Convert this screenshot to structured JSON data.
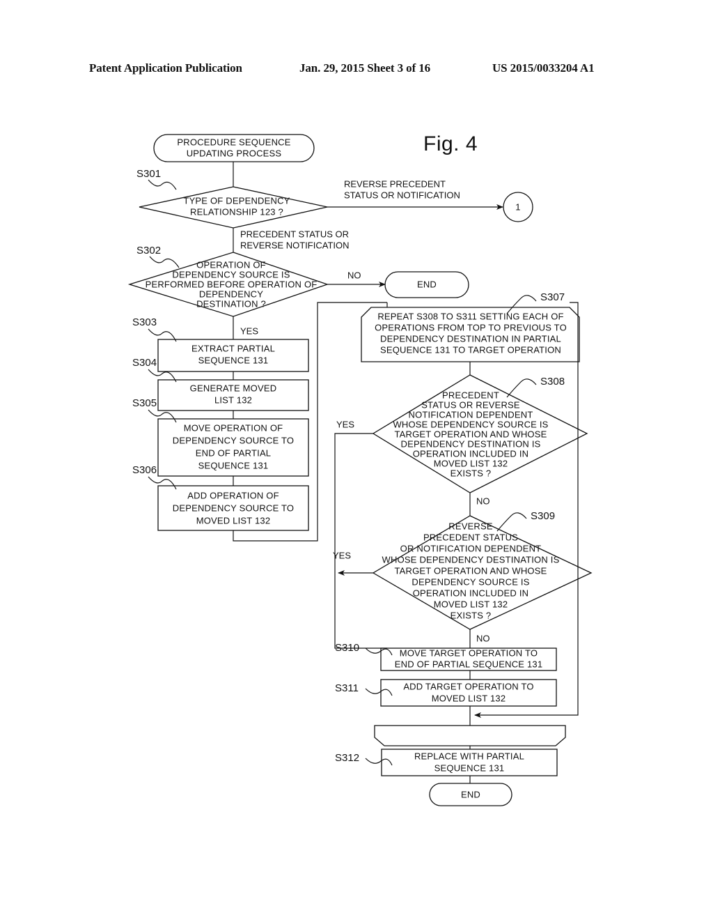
{
  "header": {
    "publication": "Patent Application Publication",
    "date_sheet": "Jan. 29, 2015  Sheet 3 of 16",
    "number": "US 2015/0033204 A1"
  },
  "figure": {
    "label": "Fig. 4"
  },
  "nodes": {
    "start": {
      "id": "start",
      "lines": [
        "PROCEDURE SEQUENCE",
        "UPDATING PROCESS"
      ]
    },
    "s301": {
      "id": "S301",
      "lines": [
        "TYPE OF DEPENDENCY",
        "RELATIONSHIP 123 ?"
      ]
    },
    "s302": {
      "id": "S302",
      "lines": [
        "OPERATION OF",
        "DEPENDENCY SOURCE IS",
        "PERFORMED BEFORE OPERATION OF",
        "DEPENDENCY",
        "DESTINATION ?"
      ]
    },
    "s303": {
      "id": "S303",
      "lines": [
        "EXTRACT PARTIAL",
        "SEQUENCE 131"
      ]
    },
    "s304": {
      "id": "S304",
      "lines": [
        "GENERATE MOVED",
        "LIST 132"
      ]
    },
    "s305": {
      "id": "S305",
      "lines": [
        "MOVE OPERATION OF",
        "DEPENDENCY SOURCE TO",
        "END OF PARTIAL",
        "SEQUENCE 131"
      ]
    },
    "s306": {
      "id": "S306",
      "lines": [
        "ADD OPERATION OF",
        "DEPENDENCY SOURCE TO",
        "MOVED LIST 132"
      ]
    },
    "s307": {
      "id": "S307",
      "lines": [
        "REPEAT S308 TO S311 SETTING EACH OF",
        "OPERATIONS FROM TOP TO PREVIOUS TO",
        "DEPENDENCY DESTINATION IN PARTIAL",
        "SEQUENCE 131 TO TARGET OPERATION"
      ]
    },
    "s308": {
      "id": "S308",
      "lines": [
        "PRECEDENT",
        "STATUS OR REVERSE",
        "NOTIFICATION DEPENDENT",
        "WHOSE DEPENDENCY SOURCE IS",
        "TARGET OPERATION AND WHOSE",
        "DEPENDENCY DESTINATION IS",
        "OPERATION INCLUDED IN",
        "MOVED LIST 132",
        "EXISTS ?"
      ]
    },
    "s309": {
      "id": "S309",
      "lines": [
        "REVERSE",
        "PRECEDENT STATUS",
        "OR NOTIFICATION DEPENDENT",
        "WHOSE DEPENDENCY DESTINATION IS",
        "TARGET OPERATION AND WHOSE",
        "DEPENDENCY SOURCE IS",
        "OPERATION INCLUDED IN",
        "MOVED LIST 132",
        "EXISTS ?"
      ]
    },
    "s310": {
      "id": "S310",
      "lines": [
        "MOVE TARGET OPERATION TO",
        "END OF PARTIAL SEQUENCE 131"
      ]
    },
    "s311": {
      "id": "S311",
      "lines": [
        "ADD TARGET OPERATION TO",
        "MOVED LIST 132"
      ]
    },
    "loopend": {
      "id": "",
      "lines": []
    },
    "s312": {
      "id": "S312",
      "lines": [
        "REPLACE WITH PARTIAL",
        "SEQUENCE 131"
      ]
    },
    "end_top": {
      "id": "",
      "lines": [
        "END"
      ]
    },
    "end_bottom": {
      "id": "",
      "lines": [
        "END"
      ]
    },
    "connector_1": {
      "id": "",
      "lines": [
        "1"
      ]
    }
  },
  "edge_labels": {
    "reverse_precedent": [
      "REVERSE PRECEDENT",
      "STATUS OR NOTIFICATION"
    ],
    "precedent_status": [
      "PRECEDENT STATUS OR",
      "REVERSE NOTIFICATION"
    ],
    "no_s302": "NO",
    "yes_s302": "YES",
    "yes_s308": "YES",
    "no_s308": "NO",
    "yes_s309": "YES",
    "no_s309": "NO"
  },
  "colors": {
    "ink": "#111111",
    "paper": "#ffffff"
  }
}
